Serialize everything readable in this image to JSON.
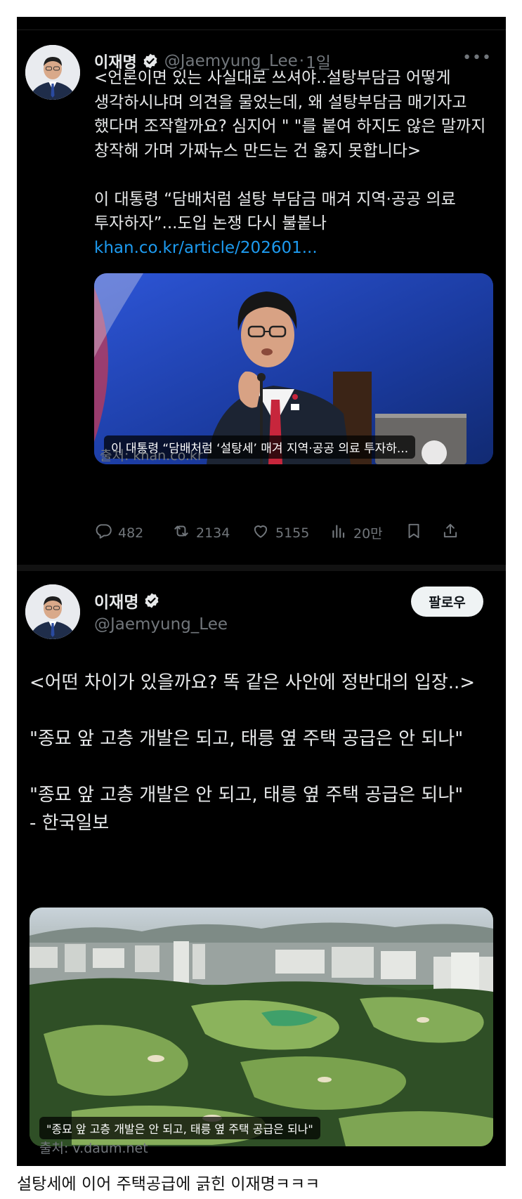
{
  "tweet1": {
    "name": "이재명",
    "handle": "@Jaemyung_Lee",
    "time": "1일",
    "body": "<언론이면 있는 사실대로 쓰셔야..설탕부담금 어떻게 생각하시냐며 의견을 물었는데, 왜 설탕부담금 매기자고 했다며 조작할까요? 심지어 \" \"를 붙여 하지도 않은 말까지 창작해 가며 가짜뉴스 만드는 건 옳지 못합니다>\n\n이 대통령 “담배처럼 설탕 부담금 매겨 지역·공공 의료 투자하자”...도입 논쟁 다시 불붙나 ",
    "link": "khan.co.kr/article/202601...",
    "card_caption": "이 대통령 “담배처럼 ‘설탕세’ 매겨 지역·공공 의료 투자하...",
    "source": "출처: khan.co.kr",
    "stats": {
      "replies": "482",
      "reposts": "2134",
      "likes": "5155",
      "views": "20만"
    }
  },
  "tweet2": {
    "name": "이재명",
    "handle": "@Jaemyung_Lee",
    "follow_label": "팔로우",
    "body": "<어떤 차이가 있을까요? 똑 같은 사안에 정반대의 입장..>\n\n\"종묘 앞 고층 개발은 되고, 태릉 옆 주택 공급은 안 되나\"\n\n\"종묘 앞 고층 개발은 안 되고, 태릉 옆 주택 공급은 되나\"\n- 한국일보",
    "card_caption": "\"종묘 앞 고층 개발은 안 되고, 태릉 옆 주택 공급은 되나\"",
    "source": "출처: v.daum.net"
  },
  "bottom_caption": "설탕세에 이어 주택공급에 긁힌 이재명ㅋㅋㅋ",
  "icons": {
    "verified": "verified-badge-icon",
    "more": "more-options-icon",
    "reply": "reply-icon",
    "repost": "repost-icon",
    "like": "heart-icon",
    "views": "views-icon",
    "bookmark": "bookmark-icon",
    "share": "share-icon"
  },
  "colors": {
    "background": "#000000",
    "text": "#e7e9ea",
    "muted": "#71767b",
    "link": "#1d9bf0"
  }
}
